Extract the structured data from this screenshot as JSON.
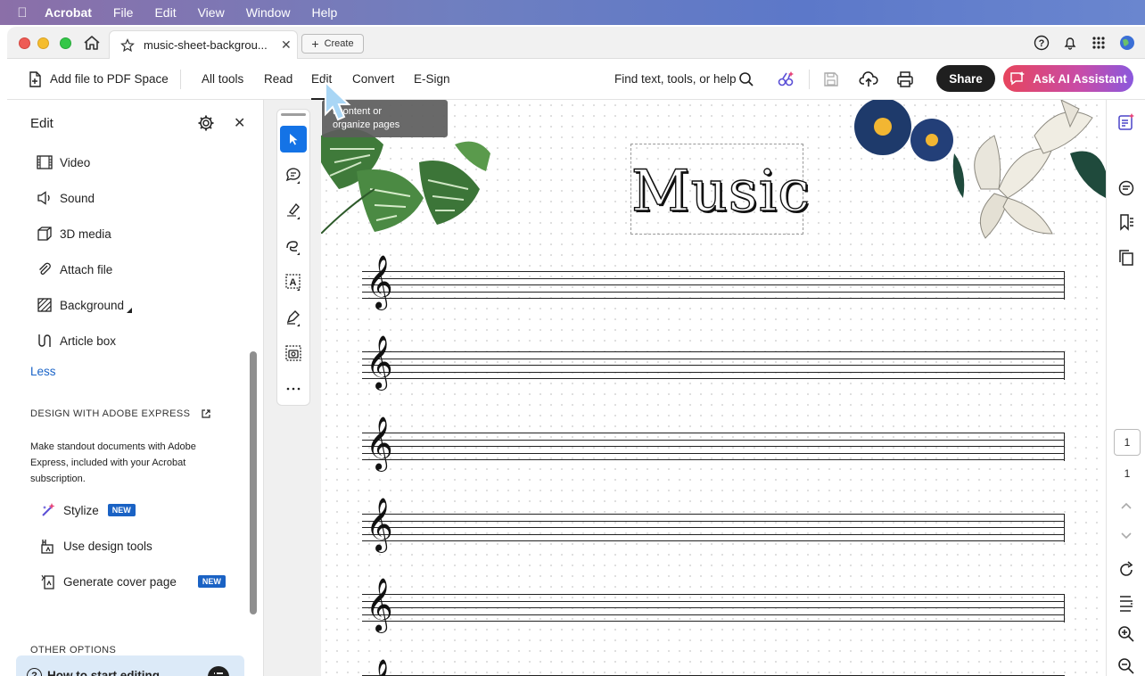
{
  "menubar": {
    "app": "Acrobat",
    "items": [
      "File",
      "Edit",
      "View",
      "Window",
      "Help"
    ]
  },
  "tab": {
    "title": "music-sheet-backgrou...",
    "create_label": "Create"
  },
  "toolbar": {
    "add_file": "Add file to PDF Space",
    "items": [
      "All tools",
      "Read",
      "Edit",
      "Convert",
      "E-Sign"
    ],
    "search": "Find text, tools, or help",
    "share": "Share",
    "ai_assistant": "Ask AI Assistant"
  },
  "tooltip": {
    "line1": "t content or",
    "line2": "organize pages"
  },
  "left_panel": {
    "title": "Edit",
    "items": [
      "Video",
      "Sound",
      "3D media",
      "Attach file",
      "Background",
      "Article box"
    ],
    "less": "Less",
    "express_heading": "DESIGN WITH ADOBE EXPRESS",
    "express_desc": "Make standout documents with Adobe Express, included with your Acrobat subscription.",
    "express_items": [
      "Stylize",
      "Use design tools",
      "Generate cover page"
    ],
    "new_badge": "NEW",
    "other_heading": "OTHER OPTIONS",
    "how_to": "How to start editing"
  },
  "document": {
    "title": "Music",
    "staff_count": 6
  },
  "right_rail": {
    "page_input": "1",
    "page_total": "1"
  },
  "colors": {
    "accent_blue": "#1473e6",
    "link_blue": "#1a64c8",
    "share_bg": "#1f1f1f",
    "ai_gradient_start": "#e7455d",
    "ai_gradient_end": "#8a58dd"
  }
}
